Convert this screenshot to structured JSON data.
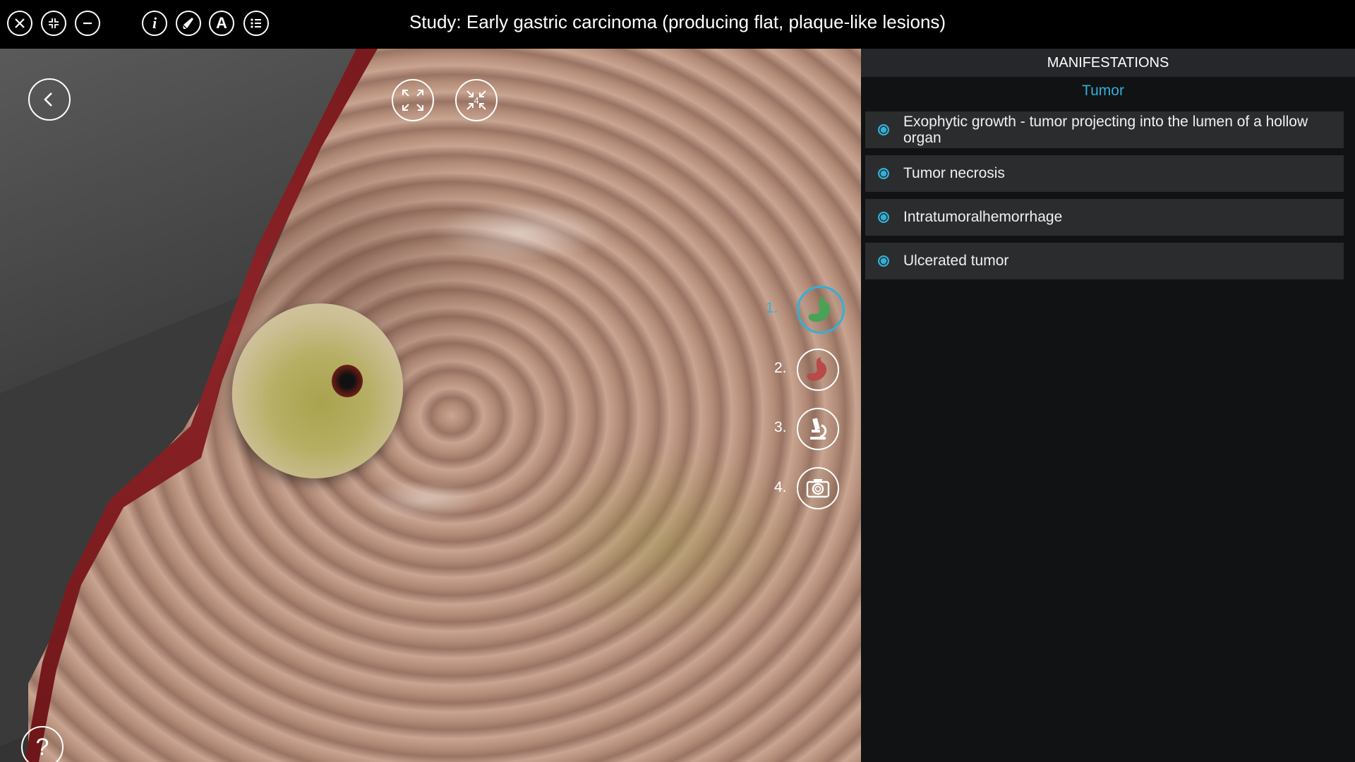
{
  "topbar": {
    "title": "Study: Early gastric carcinoma (producing flat, plaque-like lesions)",
    "icons": [
      "close-icon",
      "collapse-icon",
      "minimize-icon",
      "info-icon",
      "brush-icon",
      "annotation-a-icon",
      "list-icon"
    ]
  },
  "viewport": {
    "controls": [
      "back-icon",
      "expand-icon",
      "collapse-arrows-icon",
      "help-icon"
    ],
    "collapse_badge": "4",
    "help_label": "?",
    "steps": [
      {
        "num": "1.",
        "icon": "stomach-green-icon",
        "active": true
      },
      {
        "num": "2.",
        "icon": "stomach-red-icon",
        "active": false
      },
      {
        "num": "3.",
        "icon": "microscope-icon",
        "active": false
      },
      {
        "num": "4.",
        "icon": "camera-icon",
        "active": false
      }
    ]
  },
  "panel": {
    "header": "MANIFESTATIONS",
    "subheader": "Tumor",
    "items": [
      {
        "label": "Exophytic growth - tumor projecting into the lumen of a hollow organ"
      },
      {
        "label": "Tumor necrosis"
      },
      {
        "label": "Intratumoralhemorrhage"
      },
      {
        "label": "Ulcerated tumor"
      }
    ]
  },
  "colors": {
    "accent": "#31b0d8",
    "panel_bg": "#111214",
    "item_bg": "#2b2c2e",
    "step1_fill": "#4aa257",
    "step2_fill": "#b84a4a"
  }
}
